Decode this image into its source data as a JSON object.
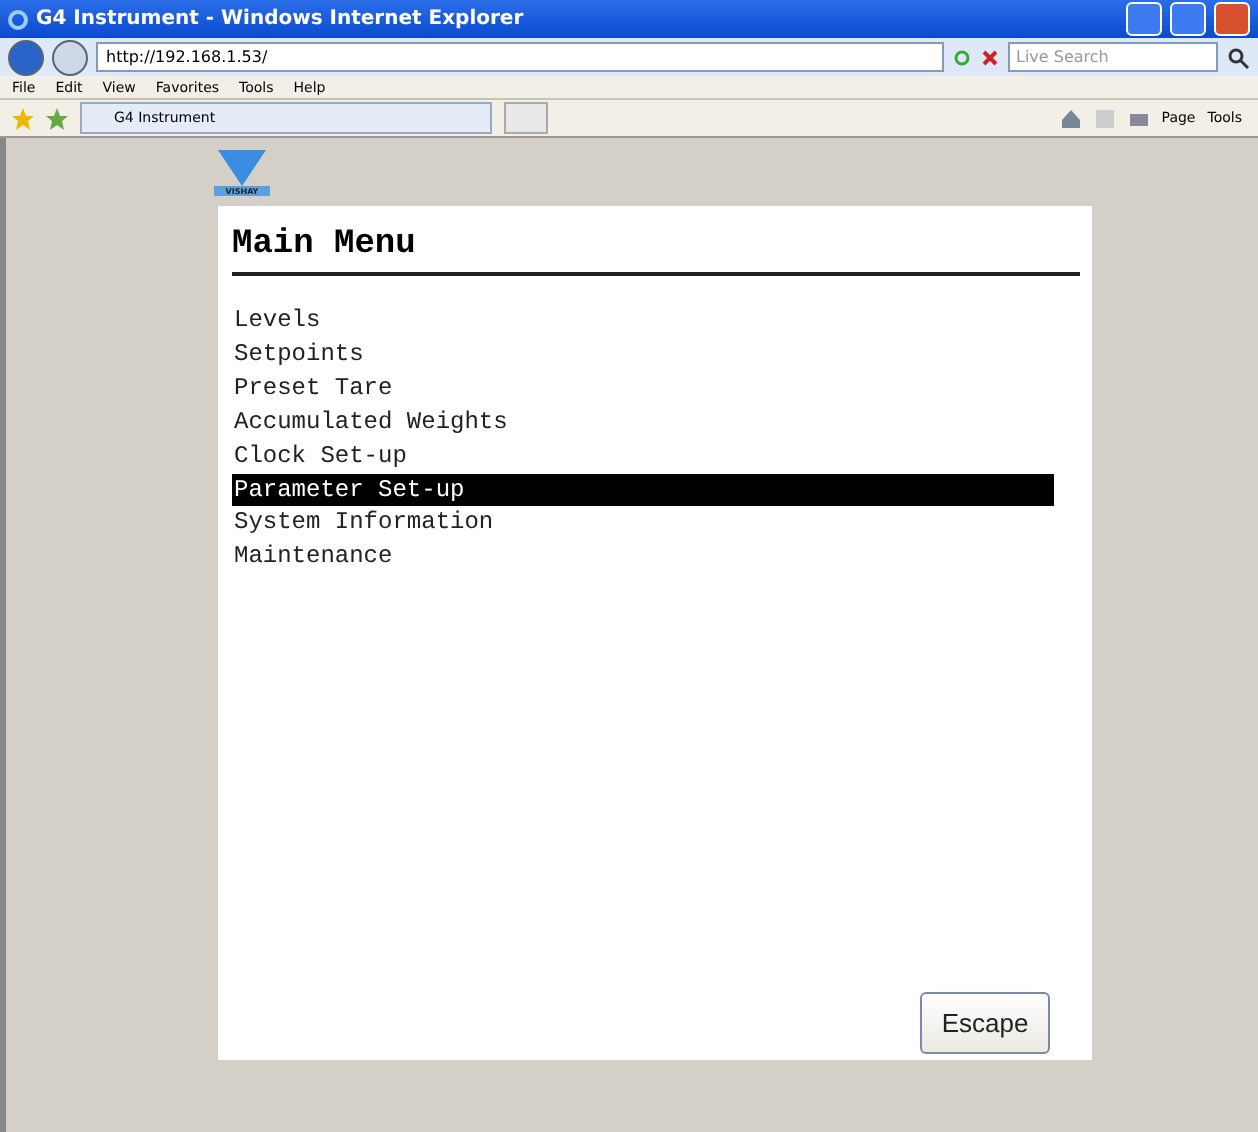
{
  "window": {
    "title": "G4 Instrument - Windows Internet Explorer"
  },
  "address_bar": {
    "value": "http://192.168.1.53/",
    "search_placeholder": "Live Search"
  },
  "menu_bar": [
    "File",
    "Edit",
    "View",
    "Favorites",
    "Tools",
    "Help"
  ],
  "tab": {
    "label": "G4 Instrument"
  },
  "command_bar": [
    "Page",
    "Tools"
  ],
  "page": {
    "logo_text": "VISHAY",
    "title": "Main Menu",
    "items": [
      {
        "label": "Levels",
        "selected": false
      },
      {
        "label": "Setpoints",
        "selected": false
      },
      {
        "label": "Preset Tare",
        "selected": false
      },
      {
        "label": "Accumulated Weights",
        "selected": false
      },
      {
        "label": "Clock Set-up",
        "selected": false
      },
      {
        "label": "Parameter Set-up",
        "selected": true
      },
      {
        "label": "System Information",
        "selected": false
      },
      {
        "label": "Maintenance",
        "selected": false
      }
    ],
    "escape_button": "Escape"
  }
}
